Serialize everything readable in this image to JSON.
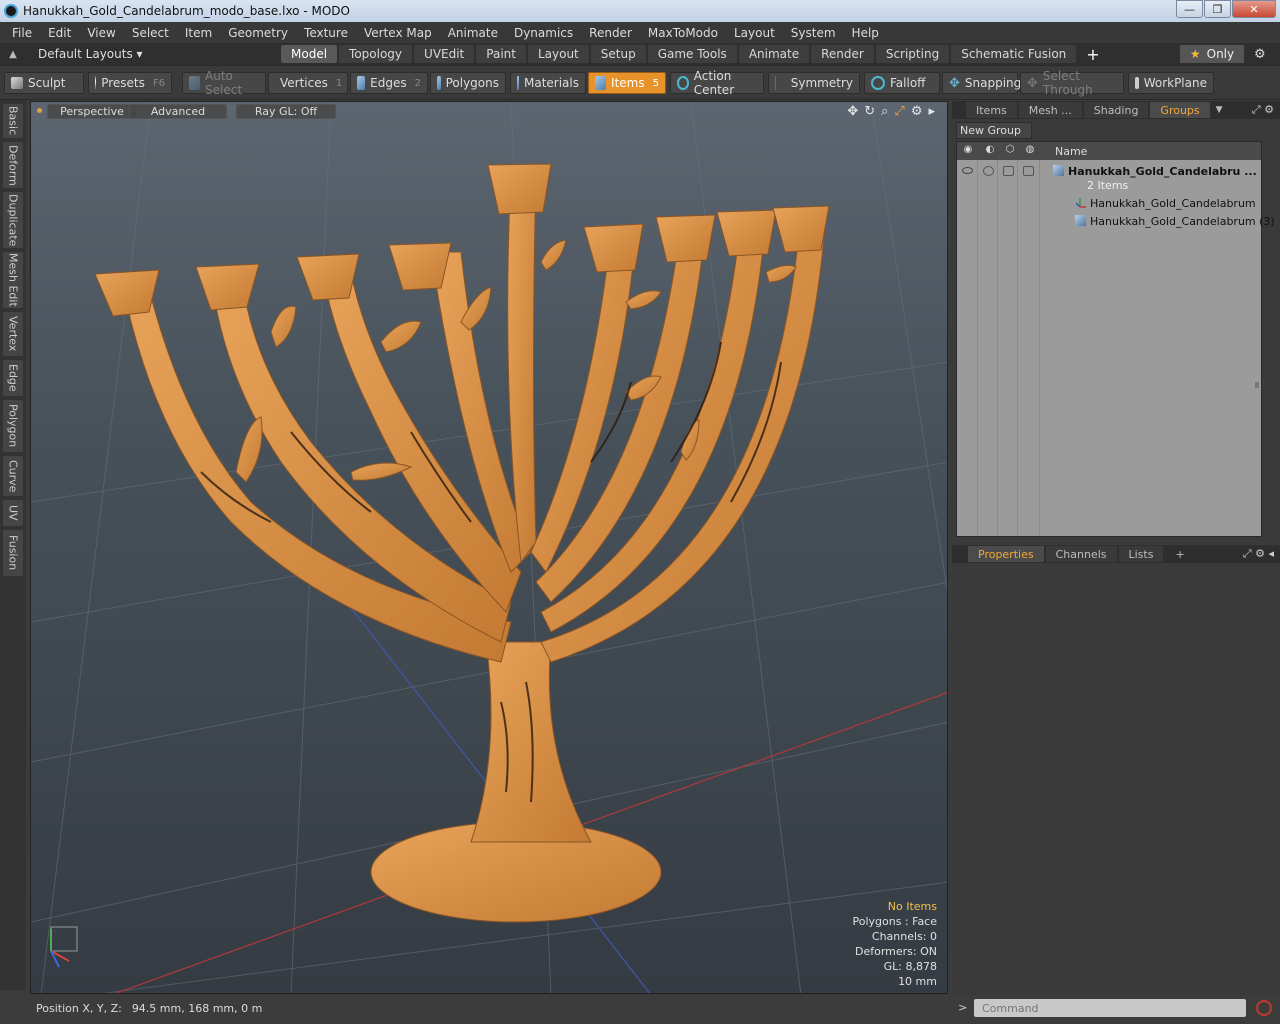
{
  "window": {
    "title": "Hanukkah_Gold_Candelabrum_modo_base.lxo - MODO",
    "controls": [
      "—",
      "❐",
      "✕"
    ]
  },
  "menu": [
    "File",
    "Edit",
    "View",
    "Select",
    "Item",
    "Geometry",
    "Texture",
    "Vertex Map",
    "Animate",
    "Dynamics",
    "Render",
    "MaxToModo",
    "Layout",
    "System",
    "Help"
  ],
  "layout_bar": {
    "layouts_label": "Default Layouts ▾",
    "tabs": [
      "Model",
      "Topology",
      "UVEdit",
      "Paint",
      "Layout",
      "Setup",
      "Game Tools",
      "Animate",
      "Render",
      "Scripting",
      "Schematic Fusion"
    ],
    "active_tab": "Model",
    "only_label": "Only"
  },
  "toolbar": {
    "sculpt": "Sculpt",
    "presets": "Presets",
    "presets_key": "F6",
    "auto_select": "Auto Select",
    "vertices": "Vertices",
    "vertices_count": "1",
    "edges": "Edges",
    "edges_count": "2",
    "polygons": "Polygons",
    "materials": "Materials",
    "items": "Items",
    "items_count": "5",
    "action_center": "Action Center",
    "symmetry": "Symmetry",
    "falloff": "Falloff",
    "snapping": "Snapping",
    "select_through": "Select Through",
    "workplane": "WorkPlane"
  },
  "left_tabs": [
    "Basic",
    "Deform",
    "Duplicate",
    "Mesh Edit",
    "Vertex",
    "Edge",
    "Polygon",
    "Curve",
    "UV",
    "Fusion"
  ],
  "viewport": {
    "view_mode": "Perspective",
    "shading": "Advanced",
    "raygl": "Ray GL: Off",
    "info": {
      "selection": "No Items",
      "polygons": "Polygons : Face",
      "channels": "Channels: 0",
      "deformers": "Deformers: ON",
      "gl": "GL: 8,878",
      "scale": "10 mm"
    }
  },
  "status": {
    "position_label": "Position X, Y, Z:",
    "position_value": "94.5 mm, 168 mm, 0 m"
  },
  "items_panel": {
    "tabs": [
      "Items",
      "Mesh ...",
      "Shading",
      "Groups"
    ],
    "active_tab": "Groups",
    "new_group": "New Group",
    "column_name": "Name",
    "group_name": "Hanukkah_Gold_Candelabru ...",
    "group_count": "2 Items",
    "children": [
      "Hanukkah_Gold_Candelabrum",
      "Hanukkah_Gold_Candelabrum (3)"
    ]
  },
  "properties_panel": {
    "tabs": [
      "Properties",
      "Channels",
      "Lists",
      "+"
    ],
    "active_tab": "Properties"
  },
  "command": {
    "placeholder": "Command"
  }
}
